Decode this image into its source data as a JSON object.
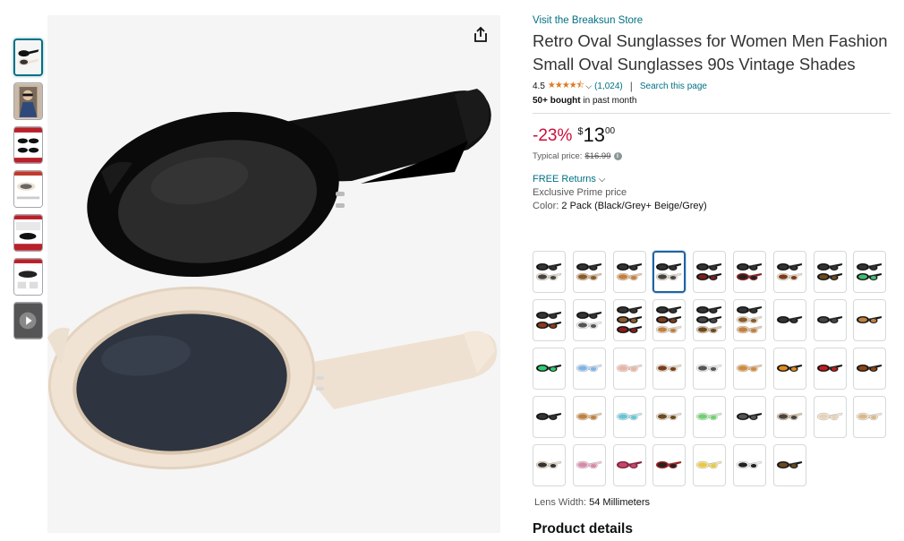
{
  "thumbnails": [
    {
      "kind": "two-glasses"
    },
    {
      "kind": "model-photo"
    },
    {
      "kind": "info-card-red"
    },
    {
      "kind": "info-card-beige"
    },
    {
      "kind": "info-card-red2"
    },
    {
      "kind": "info-card-red3"
    },
    {
      "kind": "video"
    }
  ],
  "product": {
    "store_link": "Visit the Breaksun Store",
    "title": "Retro Oval Sunglasses for Women Men Fashion Small Oval Sunglasses 90s Vintage Shades",
    "rating_value": "4.5",
    "rating_stars": "★★★★⯪",
    "rating_count": "(1,024)",
    "separator": "|",
    "search_page": "Search this page",
    "bought_bold": "50+ bought",
    "bought_rest": " in past month"
  },
  "price": {
    "discount": "-23%",
    "currency": "$",
    "whole": "13",
    "fraction": "00",
    "typical_label": "Typical price:",
    "typical_value": "$16.99",
    "info_icon": "i"
  },
  "returns_label": "FREE Returns",
  "prime_text": "Exclusive Prime price",
  "color": {
    "label": "Color:",
    "value": "2 Pack (Black/Grey+ Beige/Grey)"
  },
  "swatches": [
    {
      "frames": [
        "#111",
        "#e8dccb"
      ],
      "lenses": [
        "#333",
        "#444"
      ]
    },
    {
      "frames": [
        "#111",
        "#d9c2a7"
      ],
      "lenses": [
        "#333",
        "#8a5a2b"
      ]
    },
    {
      "frames": [
        "#111",
        "#e6c7a6"
      ],
      "lenses": [
        "#333",
        "#c08040"
      ]
    },
    {
      "frames": [
        "#111",
        "#e8dccb"
      ],
      "lenses": [
        "#333",
        "#444"
      ]
    },
    {
      "frames": [
        "#111",
        "#111"
      ],
      "lenses": [
        "#333",
        "#7a1f1f"
      ]
    },
    {
      "frames": [
        "#111",
        "#8b1a1a"
      ],
      "lenses": [
        "#333",
        "#222"
      ]
    },
    {
      "frames": [
        "#111",
        "#e8dccb"
      ],
      "lenses": [
        "#333",
        "#7a3b1c"
      ]
    },
    {
      "frames": [
        "#111",
        "#111"
      ],
      "lenses": [
        "#333",
        "#6b4a20"
      ]
    },
    {
      "frames": [
        "#111",
        "#111"
      ],
      "lenses": [
        "#333",
        "#3fbf6f"
      ]
    },
    {
      "frames": [
        "#111",
        "#111"
      ],
      "lenses": [
        "#333",
        "#8b3b1a"
      ]
    },
    {
      "frames": [
        "#111",
        "#eee"
      ],
      "lenses": [
        "#333",
        "#555"
      ]
    },
    {
      "frames": [
        "#111",
        "#111",
        "#111"
      ],
      "lenses": [
        "#333",
        "#8a5a2b",
        "#8b1a1a"
      ]
    },
    {
      "frames": [
        "#111",
        "#111",
        "#e8dccb"
      ],
      "lenses": [
        "#333",
        "#7a3b1c",
        "#c08040"
      ]
    },
    {
      "frames": [
        "#111",
        "#111",
        "#d9c2a7"
      ],
      "lenses": [
        "#333",
        "#444",
        "#6b4a20"
      ]
    },
    {
      "frames": [
        "#111",
        "#e8dccb",
        "#e6c7a6"
      ],
      "lenses": [
        "#333",
        "#8a5a2b",
        "#c08040"
      ]
    },
    {
      "frames": [
        "#111"
      ],
      "lenses": [
        "#333"
      ]
    },
    {
      "frames": [
        "#111"
      ],
      "lenses": [
        "#444"
      ]
    },
    {
      "frames": [
        "#111"
      ],
      "lenses": [
        "#c08040"
      ]
    },
    {
      "frames": [
        "#111"
      ],
      "lenses": [
        "#2ecc71"
      ]
    },
    {
      "frames": [
        "#cfe3f7"
      ],
      "lenses": [
        "#7fb3e6"
      ]
    },
    {
      "frames": [
        "#f4d8d0"
      ],
      "lenses": [
        "#e8b4a6"
      ]
    },
    {
      "frames": [
        "#e8dccb"
      ],
      "lenses": [
        "#7a3b1c"
      ]
    },
    {
      "frames": [
        "#eee"
      ],
      "lenses": [
        "#555"
      ]
    },
    {
      "frames": [
        "#e6c7a6"
      ],
      "lenses": [
        "#d28b3a"
      ]
    },
    {
      "frames": [
        "#111"
      ],
      "lenses": [
        "#e08a1e"
      ]
    },
    {
      "frames": [
        "#111"
      ],
      "lenses": [
        "#c21d1d"
      ]
    },
    {
      "frames": [
        "#111"
      ],
      "lenses": [
        "#8b4513"
      ]
    },
    {
      "frames": [
        "#111"
      ],
      "lenses": [
        "#333"
      ]
    },
    {
      "frames": [
        "#e6c7a6"
      ],
      "lenses": [
        "#c08040"
      ]
    },
    {
      "frames": [
        "#bfe8f0"
      ],
      "lenses": [
        "#67c4d6"
      ]
    },
    {
      "frames": [
        "#e8dccb"
      ],
      "lenses": [
        "#6b4a20"
      ]
    },
    {
      "frames": [
        "#c8f0c8"
      ],
      "lenses": [
        "#6fd06f"
      ]
    },
    {
      "frames": [
        "#111"
      ],
      "lenses": [
        "#555"
      ]
    },
    {
      "frames": [
        "#d9c2a7"
      ],
      "lenses": [
        "#444"
      ]
    },
    {
      "frames": [
        "#f2e6d6"
      ],
      "lenses": [
        "#e6d2b8"
      ]
    },
    {
      "frames": [
        "#f2e6d6"
      ],
      "lenses": [
        "#d9b98a"
      ]
    },
    {
      "frames": [
        "#e8dccb"
      ],
      "lenses": [
        "#333"
      ]
    },
    {
      "frames": [
        "#f0c8d8"
      ],
      "lenses": [
        "#d68aa8"
      ]
    },
    {
      "frames": [
        "#8b1a3a"
      ],
      "lenses": [
        "#c04a6a"
      ]
    },
    {
      "frames": [
        "#a01818"
      ],
      "lenses": [
        "#222"
      ]
    },
    {
      "frames": [
        "#f5e6a8"
      ],
      "lenses": [
        "#e6c84a"
      ]
    },
    {
      "frames": [
        "#eee"
      ],
      "lenses": [
        "#222"
      ]
    },
    {
      "frames": [
        "#111"
      ],
      "lenses": [
        "#6b4a20"
      ]
    }
  ],
  "selected_swatch": 3,
  "lens_width": {
    "label": "Lens Width: ",
    "value": "54 Millimeters"
  },
  "product_details_heading": "Product details"
}
